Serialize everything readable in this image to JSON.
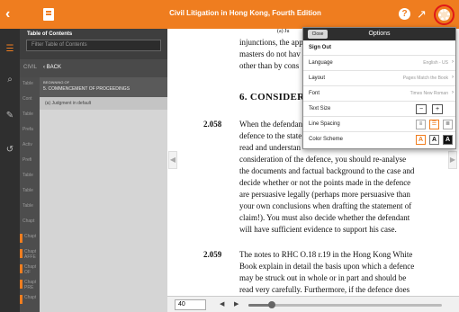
{
  "topbar": {
    "back_icon": "‹",
    "title": "Civil Litigation in Hong Kong, Fourth Edition",
    "help_icon": "?",
    "share_icon": "↗",
    "bg": "#ef7d1f",
    "gear_highlight": "#e01818"
  },
  "rail": {
    "toc_icon": "☰",
    "search_icon": "⌕",
    "notes_icon": "✎",
    "history_icon": "↺"
  },
  "toc": {
    "label": "Table of Contents",
    "filter_placeholder": "Filter Table of Contents",
    "crumb": "CIVIL",
    "back_label": "‹ BACK",
    "section_top": "BEGINNING OF",
    "section_title": "5. COMMENCEMENT OF PROCEEDINGS",
    "item": "(a) Judgment in default",
    "strip_items": [
      "Table",
      "Cont",
      "Table",
      "Prefa",
      "Activ",
      "Prefi",
      "Table",
      "Table",
      "Table",
      "Chapt",
      "Chapt",
      "Chapt AFFE",
      "Chapt OF",
      "Chapt PRE",
      "Chapt"
    ]
  },
  "content": {
    "running_head": "(a) Ju",
    "lines_top": [
      "injunctions, the app",
      "masters do not hav",
      "other than by cons"
    ],
    "heading": "6. CONSIDERAT",
    "para1_num": "2.058",
    "para1": [
      "When the defendan",
      "defence to the state",
      "read and understan",
      "consideration of the defence, you should re-analyse",
      "the documents and factual background to the case and",
      "decide whether or not the points made in the defence",
      "are persuasive legally (perhaps more persuasive than",
      "your own conclusions when drafting the statement of",
      "claim!). You must also decide whether the defendant",
      "will have sufficient evidence to support his case."
    ],
    "para2_num": "2.059",
    "para2": [
      "The notes to RHC O.18 r.19 in the Hong Kong White",
      "Book explain in detail the basis upon which a defence",
      "may be struck out in whole or in part and should be",
      "read very carefully. Furthermore, if the defence does"
    ]
  },
  "bottombar": {
    "page": "40",
    "prev": "◀",
    "next": "▶",
    "progress": 0.12
  },
  "options": {
    "close_label": "Close",
    "title": "Options",
    "sign_out": "Sign Out",
    "language_label": "Language",
    "language_value": "English - US",
    "layout_label": "Layout",
    "layout_value": "Pages Match the Book",
    "font_label": "Font",
    "font_value": "Times New Roman",
    "text_size_label": "Text Size",
    "minus": "−",
    "plus": "+",
    "line_spacing_label": "Line Spacing",
    "ls1": "≡",
    "ls2": "☰",
    "ls3": "≣",
    "color_scheme_label": "Color Scheme",
    "cs1": "A",
    "cs2": "A",
    "cs3": "A",
    "chevron": "›"
  }
}
